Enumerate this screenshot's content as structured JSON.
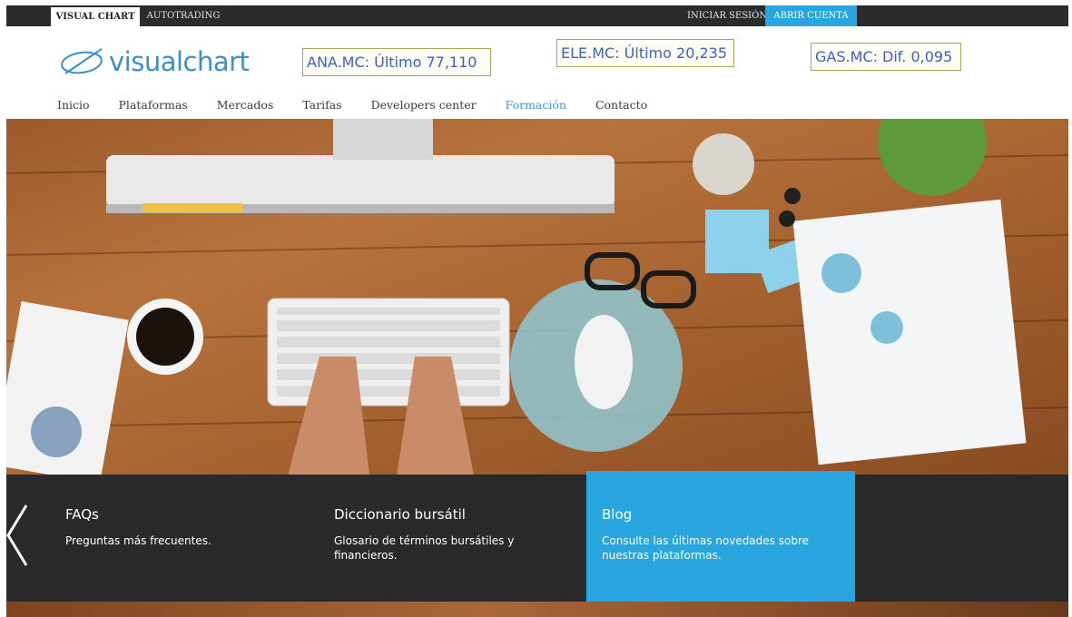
{
  "topbar": {
    "tab_active": "VISUAL CHART",
    "tab_inactive": "AUTOTRADING",
    "login": "INICIAR SESIÓN",
    "open_account": "ABRIR CUENTA"
  },
  "header": {
    "logo_text": "visualchart",
    "tickers": [
      "ANA.MC: Último 77,110",
      "ELE.MC: Último 20,235",
      "GAS.MC: Dif. 0,095"
    ]
  },
  "nav": [
    "Inicio",
    "Plataformas",
    "Mercados",
    "Tarifas",
    "Developers center",
    "Formación",
    "Contacto"
  ],
  "nav_active_index": 5,
  "colors": {
    "accent": "#29a6df",
    "topbar": "#2b2b2d",
    "panel": "#2a2a2d",
    "logo": "#3a8fd1",
    "ticker_text": "#3f5fc4"
  },
  "panel": {
    "tiles": [
      {
        "title": "FAQs",
        "desc_1": "Preguntas más frecuentes.",
        "desc_2": ""
      },
      {
        "title": "Diccionario bursátil",
        "desc_1": "Glosario de términos bursátiles y",
        "desc_2": "financieros."
      },
      {
        "title": "Blog",
        "desc_1": "Consulte las últimas novedades sobre",
        "desc_2": "nuestras plataformas."
      }
    ]
  },
  "icons": {
    "logo_mark": "visualchart-logo-icon",
    "prev": "chevron-left-icon"
  }
}
